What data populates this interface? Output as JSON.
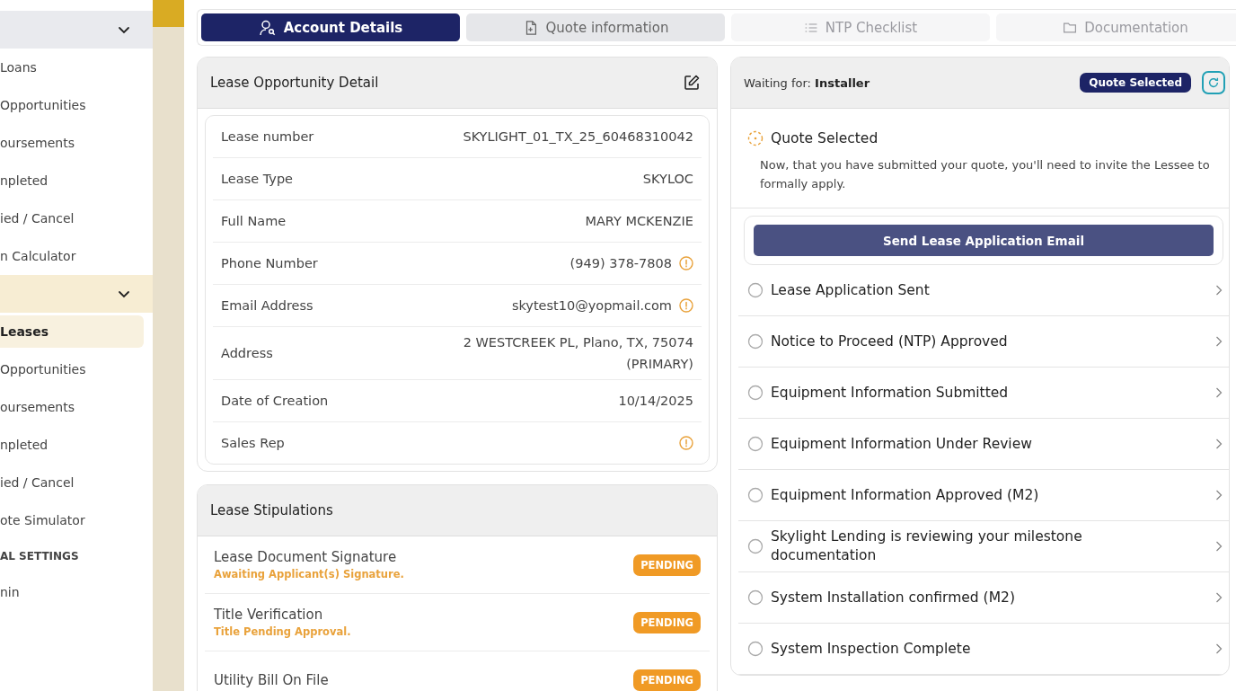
{
  "sidebar": {
    "groups": [
      {
        "expanded": true,
        "highlighted": false,
        "items": [
          {
            "label": "Loans",
            "selected": false
          },
          {
            "label": "Opportunities",
            "selected": false
          },
          {
            "label": "oursements",
            "selected": false
          },
          {
            "label": "npleted",
            "selected": false
          },
          {
            "label": "ied / Cancel",
            "selected": false
          },
          {
            "label": "n Calculator",
            "selected": false
          }
        ]
      },
      {
        "expanded": true,
        "highlighted": true,
        "items": [
          {
            "label": "Leases",
            "selected": true
          },
          {
            "label": "Opportunities",
            "selected": false
          },
          {
            "label": "oursements",
            "selected": false
          },
          {
            "label": "npleted",
            "selected": false
          },
          {
            "label": "ied / Cancel",
            "selected": false
          },
          {
            "label": "ote Simulator",
            "selected": false
          }
        ]
      }
    ],
    "section_label": "AL SETTINGS",
    "footer_items": [
      {
        "label": "nin",
        "selected": false
      }
    ]
  },
  "tabs": [
    {
      "label": "Account Details",
      "selected": true,
      "disabled": false
    },
    {
      "label": "Quote information",
      "selected": false,
      "disabled": false
    },
    {
      "label": "NTP Checklist",
      "selected": false,
      "disabled": true
    },
    {
      "label": "Documentation",
      "selected": false,
      "disabled": true
    }
  ],
  "detail": {
    "title": "Lease Opportunity Detail",
    "rows": [
      {
        "label": "Lease number",
        "value": "SKYLIGHT_01_TX_25_60468310042",
        "warning": false
      },
      {
        "label": "Lease Type",
        "value": "SKYLOC",
        "warning": false
      },
      {
        "label": "Full Name",
        "value": "MARY MCKENZIE",
        "warning": false
      },
      {
        "label": "Phone Number",
        "value": "(949) 378-7808",
        "warning": true
      },
      {
        "label": "Email Address",
        "value": "skytest10@yopmail.com",
        "warning": true
      },
      {
        "label": "Address",
        "value": "2 WESTCREEK PL, Plano, TX, 75074 (PRIMARY)",
        "warning": false
      },
      {
        "label": "Date of Creation",
        "value": "10/14/2025",
        "warning": false
      },
      {
        "label": "Sales Rep",
        "warning": true
      }
    ]
  },
  "stipulations": {
    "title": "Lease Stipulations",
    "items": [
      {
        "title": "Lease Document Signature",
        "note": "Awaiting Applicant(s) Signature.",
        "status": "PENDING",
        "kind": "pending"
      },
      {
        "title": "Title Verification",
        "note": "Title Pending Approval.",
        "status": "PENDING",
        "kind": "pending"
      },
      {
        "title": "Utility Bill On File",
        "status": "PENDING",
        "kind": "pending"
      }
    ]
  },
  "progress": {
    "waiting_label": "Waiting for:",
    "waiting_for": "Installer",
    "badge": "Quote Selected",
    "current": {
      "title": "Quote Selected",
      "description": "Now, that you have submitted your quote, you'll need to invite the Lessee to formally apply.",
      "button": "Send Lease Application Email"
    },
    "steps": [
      {
        "label": "Lease Application Sent",
        "done": false
      },
      {
        "label": "Notice to Proceed (NTP) Approved",
        "done": false
      },
      {
        "label": "Equipment Information Submitted",
        "done": false
      },
      {
        "label": "Equipment Information Under Review",
        "done": false
      },
      {
        "label": "Equipment Information Approved (M2)",
        "done": false
      },
      {
        "label": "Skylight Lending is reviewing your milestone documentation",
        "done": false
      },
      {
        "label": "System Installation confirmed (M2)",
        "done": false
      },
      {
        "label": "System Inspection Complete",
        "done": false
      }
    ]
  }
}
